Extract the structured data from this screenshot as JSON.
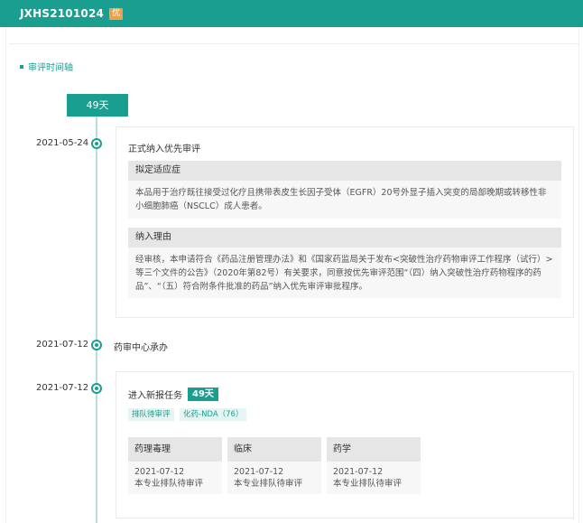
{
  "header": {
    "title": "JXHS2101024",
    "badge": "优"
  },
  "section_title": "审评时间轴",
  "total_duration": "49天",
  "events": [
    {
      "date": "2021-05-24",
      "title": "正式纳入优先审评",
      "blocks": [
        {
          "heading": "拟定适应症",
          "body": "本品用于治疗既往接受过化疗且携带表皮生长因子受体（EGFR）20号外显子插入突变的局部晚期或转移性非小细胞肺癌（NSCLC）成人患者。"
        },
        {
          "heading": "纳入理由",
          "body": "经审核，本申请符合《药品注册管理办法》和《国家药监局关于发布<突破性治疗药物审评工作程序（试行）>等三个文件的公告》（2020年第82号）有关要求，同意按优先审评范围“（四）纳入突破性治疗药物程序的药品”、“（五）符合附条件批准的药品”纳入优先审评审批程序。"
        }
      ]
    },
    {
      "date": "2021-07-12",
      "title": "药审中心承办"
    },
    {
      "date": "2021-07-12",
      "title": "进入新报任务",
      "duration": "49天",
      "tags": [
        "排队待审评",
        "化药-NDA（76）"
      ],
      "columns": [
        {
          "heading": "药理毒理",
          "date": "2021-07-12",
          "status": "本专业排队待审评"
        },
        {
          "heading": "临床",
          "date": "2021-07-12",
          "status": "本专业排队待审评"
        },
        {
          "heading": "药学",
          "date": "2021-07-12",
          "status": "本专业排队待审评"
        }
      ]
    }
  ]
}
